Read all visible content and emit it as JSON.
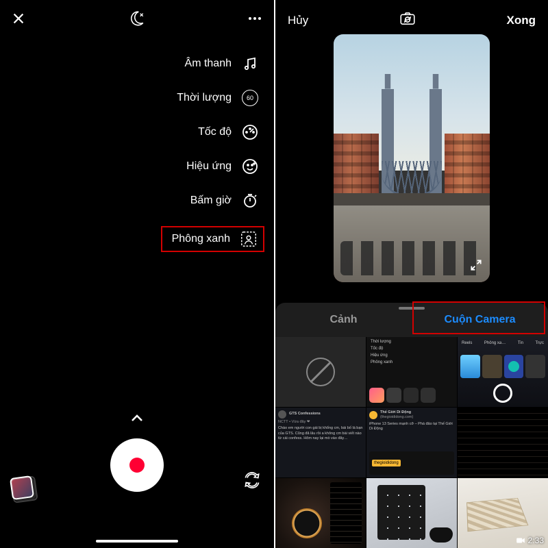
{
  "left": {
    "menu": [
      {
        "label": "Âm thanh",
        "icon": "music"
      },
      {
        "label": "Thời lượng",
        "icon": "sixty"
      },
      {
        "label": "Tốc độ",
        "icon": "gauge"
      },
      {
        "label": "Hiệu ứng",
        "icon": "sparkle"
      },
      {
        "label": "Bấm giờ",
        "icon": "timer"
      },
      {
        "label": "Phông xanh",
        "icon": "greenscreen",
        "highlight": true
      }
    ],
    "sixty_value": "60"
  },
  "right": {
    "cancel": "Hủy",
    "done": "Xong",
    "tabs": {
      "scene": "Cảnh",
      "cameraroll": "Cuộn Camera"
    },
    "video_duration": "2:33",
    "post_author": "GTS Confessions",
    "post_author2": "Thế Giới Di Động",
    "post_handle": "(thegioididong.com)",
    "ylabel": "thegioididong"
  }
}
